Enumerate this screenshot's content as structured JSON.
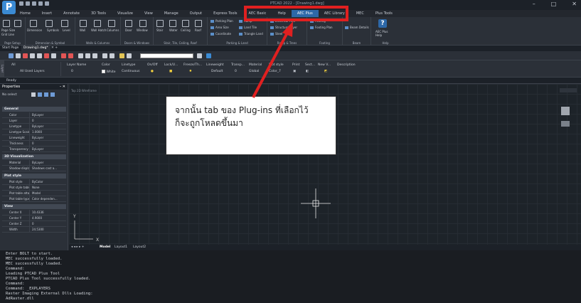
{
  "app": {
    "logo": "P",
    "window_title": "PTCAD 2022 - [Drawing1.dwg]",
    "window_buttons": [
      "–",
      "□",
      "✕"
    ]
  },
  "ribbon_tabs": [
    "Home",
    "Insert",
    "Annotate",
    "3D Tools",
    "Visualize",
    "View",
    "Manage",
    "Output",
    "Express Tools",
    "AEC Basic",
    "Help",
    "AEC Plus",
    "AEC Library",
    "MEC",
    "Plus Tools"
  ],
  "active_tab": "AEC Plus",
  "ribbon": {
    "page_setup": {
      "buttons": [
        "Page Size",
        "Grid Line",
        "Dimension"
      ],
      "label": "Page Setup"
    },
    "dim_symbol": {
      "buttons": [
        "Symbols",
        "Level"
      ],
      "label": "Dimension & Symbol"
    },
    "walls": {
      "buttons": [
        "Wall",
        "Wall Hatch",
        "Columns"
      ],
      "label": "Walls & Columns"
    },
    "doors": {
      "buttons": [
        "Door",
        "Window"
      ],
      "label": "Doors & Windows"
    },
    "stair": {
      "buttons": [
        "Stair",
        "Water",
        "Ceiling",
        "Roof"
      ],
      "label": "Stair, Tile, Ceiling, Roof"
    },
    "parking": {
      "items": [
        "Parking Plan",
        "Area Size",
        "Coordinate"
      ],
      "items2": [
        "Ramp",
        "Land Tile",
        "Triangle Land"
      ],
      "label": "Parking & Land"
    },
    "ramp": {
      "items": [
        "Electrical Plan",
        "Structure Layer",
        "Steel"
      ],
      "label": "Ramp & Trees"
    },
    "footing": {
      "items": [
        "Footing",
        "Footing Plan"
      ],
      "label": "Footing"
    },
    "beam": {
      "items": [
        "Beam Details"
      ],
      "label": "Beam"
    },
    "help": {
      "items": [
        "AEC Plus Help"
      ],
      "label": "Help"
    }
  },
  "file_tabs": [
    "Start Page",
    "Drawing1.dwg*"
  ],
  "layer_bar": {
    "headers": [
      "Layer Name",
      "Color",
      "Linetype",
      "On/Off",
      "Lock/U...",
      "Freeze/Th...",
      "Lineweight",
      "Transp...",
      "Material",
      "Plot style",
      "Print",
      "Sect...",
      "New V...",
      "Description"
    ],
    "tree": [
      "All",
      "All Used Layers"
    ],
    "row": {
      "name": "0",
      "color": "White",
      "linetype": "Continuous",
      "lineweight": "Default",
      "transp": "0",
      "material": "Global",
      "plotstyle": "Color_7"
    }
  },
  "ready": "Ready",
  "properties": {
    "title": "Properties",
    "selection": "No select",
    "sections": [
      {
        "name": "General",
        "rows": [
          [
            "Color",
            "ByLayer"
          ],
          [
            "Layer",
            "0"
          ],
          [
            "Linetype",
            "ByLayer"
          ],
          [
            "Linetype Scale",
            "1.0000"
          ],
          [
            "Lineweight",
            "ByLayer"
          ],
          [
            "Thickness",
            "0"
          ],
          [
            "Transparency",
            "ByLayer"
          ]
        ]
      },
      {
        "name": "3D Visualization",
        "rows": [
          [
            "Material",
            "ByLayer"
          ],
          [
            "Shadow display",
            "Shadows cast a..."
          ]
        ]
      },
      {
        "name": "Plot style",
        "rows": [
          [
            "Plot style",
            "ByColor"
          ],
          [
            "Plot style table",
            "None"
          ],
          [
            "Plot table attac...",
            "Model"
          ],
          [
            "Plot table type",
            "Color dependen..."
          ]
        ]
      },
      {
        "name": "View",
        "rows": [
          [
            "Center X",
            "10.4336"
          ],
          [
            "Center Y",
            "4.9000"
          ],
          [
            "Center Z",
            "0"
          ],
          [
            "Width",
            "24.5300"
          ]
        ]
      }
    ]
  },
  "drawing": {
    "top_tab": "Top  2D Wireframe",
    "layout_tabs": [
      "Model",
      "Layout1",
      "Layout2"
    ]
  },
  "callout": {
    "line1": "จากนั้น tab ของ Plug-ins ที่เลือกไว้",
    "line2": "ก็จะถูกโหลดขึ้นมา"
  },
  "command_lines": [
    "Enter BOLT to start.",
    "MEC successfully loaded.",
    "MEC successfully loaded.",
    "Command:",
    "Loading PTCAD Plus Tool",
    "PTCAD Plus Tool successfully loaded.",
    "Command:",
    "Command: _EXPLAYERS",
    "Raster Imaging External Dlls Loading:",
    "AdRaster.dll"
  ],
  "colors": {
    "highlight": "#e02020",
    "accent": "#2d68a8"
  }
}
